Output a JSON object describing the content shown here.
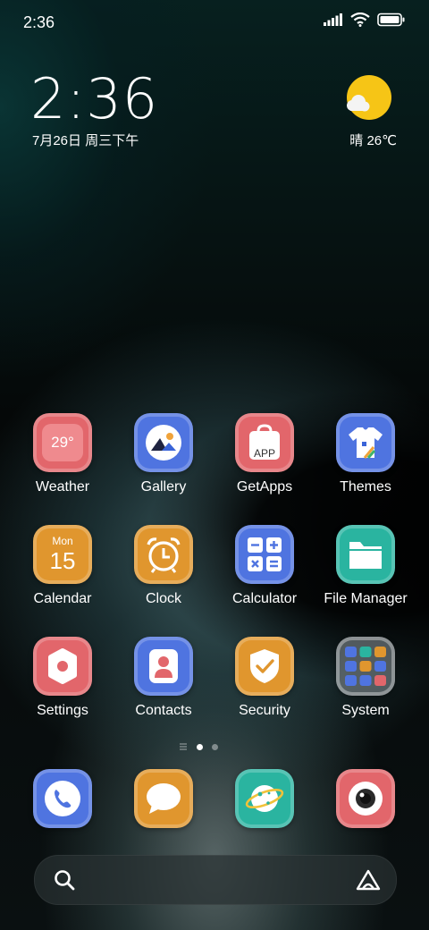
{
  "status_bar": {
    "time": "2:36",
    "icons": [
      "signal-icon",
      "wifi-icon",
      "battery-icon"
    ]
  },
  "lock_widget": {
    "time": "2:36",
    "date": "7月26日 周三下午",
    "weather": "晴 26℃",
    "weather_icon": "sun-cloud-icon"
  },
  "apps": [
    {
      "label": "Weather",
      "icon": "weather-icon",
      "color": "#e2666b",
      "text": "29°"
    },
    {
      "label": "Gallery",
      "icon": "gallery-icon",
      "color": "#4f74e0"
    },
    {
      "label": "GetApps",
      "icon": "getapps-icon",
      "color": "#e2666b",
      "text": "APP"
    },
    {
      "label": "Themes",
      "icon": "themes-icon",
      "color": "#4f74e0"
    },
    {
      "label": "Calendar",
      "icon": "calendar-icon",
      "color": "#e0962e",
      "day": "Mon",
      "date": "15"
    },
    {
      "label": "Clock",
      "icon": "clock-icon",
      "color": "#e0962e"
    },
    {
      "label": "Calculator",
      "icon": "calculator-icon",
      "color": "#4f74e0"
    },
    {
      "label": "File Manager",
      "icon": "folder-icon",
      "color": "#2ab4a0"
    },
    {
      "label": "Settings",
      "icon": "settings-icon",
      "color": "#e2666b"
    },
    {
      "label": "Contacts",
      "icon": "contacts-icon",
      "color": "#4f74e0"
    },
    {
      "label": "Security",
      "icon": "security-icon",
      "color": "#e0962e"
    },
    {
      "label": "System",
      "icon": "folder-system-icon",
      "color": "#aab2b5"
    }
  ],
  "dock": [
    {
      "icon": "phone-icon",
      "color": "#4f74e0"
    },
    {
      "icon": "messaging-icon",
      "color": "#e0962e"
    },
    {
      "icon": "browser-icon",
      "color": "#2ab4a0"
    },
    {
      "icon": "camera-icon",
      "color": "#e2666b"
    }
  ],
  "page_indicator": {
    "pages": 2,
    "current": 1
  },
  "search": {
    "icon": "search-icon",
    "assistant_icon": "assistant-icon"
  }
}
